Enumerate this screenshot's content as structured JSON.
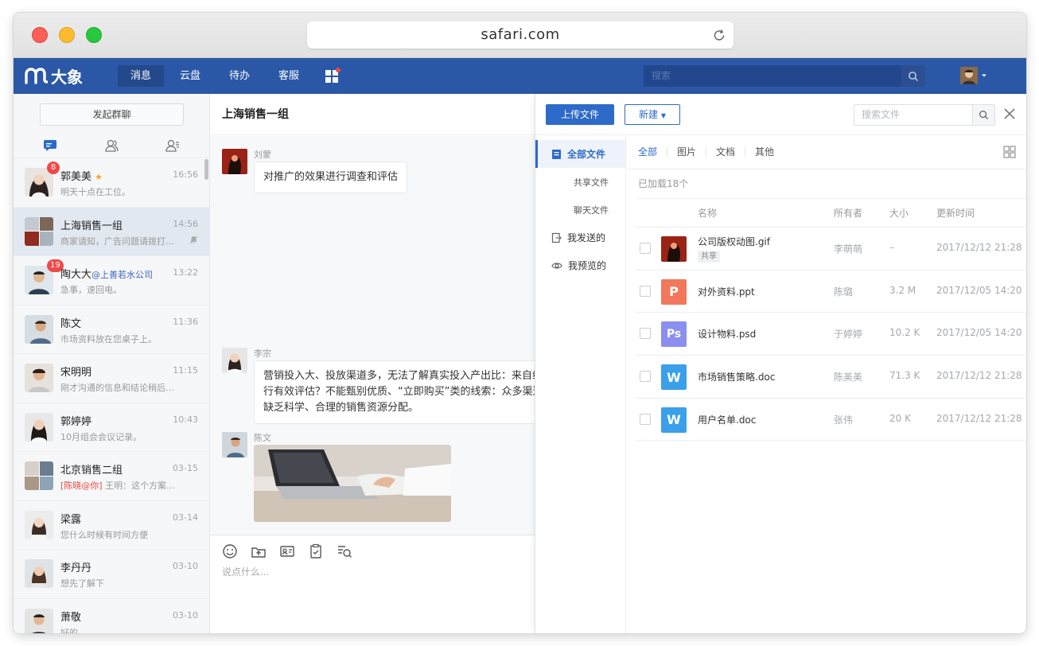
{
  "browser": {
    "url": "safari.com"
  },
  "app": {
    "logo_text": "大象",
    "nav": [
      "消息",
      "云盘",
      "待办",
      "客服"
    ],
    "search_placeholder": "搜索"
  },
  "sidebar": {
    "start_group": "发起群聊",
    "conversations": [
      {
        "name": "郭美美",
        "time": "16:56",
        "preview": "明天十点在工位。",
        "badge": "8",
        "starred": true
      },
      {
        "name": "上海销售一组",
        "time": "14:56",
        "preview": "商家请知，广告问题请拨打...",
        "group": true,
        "muted": true
      },
      {
        "name": "陶大大",
        "tag": "@上善若水公司",
        "time": "13:22",
        "preview": "急事，速回电。",
        "badge": "19"
      },
      {
        "name": "陈文",
        "time": "11:36",
        "preview": "市场资料放在您桌子上。"
      },
      {
        "name": "宋明明",
        "time": "11:15",
        "preview": "刚才沟通的信息和结论稍后我..."
      },
      {
        "name": "郭婷婷",
        "time": "10:43",
        "preview": "10月组会会议记录。"
      },
      {
        "name": "北京销售二组",
        "time": "03-15",
        "preview_highlight": "[陈晓@你]",
        "preview": " 王明：这个方案...",
        "group": true
      },
      {
        "name": "梁露",
        "time": "03-14",
        "preview": "您什么时候有时间方便"
      },
      {
        "name": "李丹丹",
        "time": "03-10",
        "preview": "想先了解下"
      },
      {
        "name": "萧敬",
        "time": "03-10",
        "preview": "好的"
      }
    ]
  },
  "chat": {
    "title": "上海销售一组",
    "messages": [
      {
        "sender": "刘蒙",
        "text": "对推广的效果进行调查和评估"
      },
      {
        "sender": "李宗",
        "lines": [
          "营销投入大、投放渠道多，无法了解真实投入产出比：来自线上",
          "行有效评估？不能甄别优质、“立即购买”类的线索：众多渠道来",
          "缺乏科学、合理的销售资源分配。"
        ]
      },
      {
        "sender": "陈文",
        "text": ""
      }
    ],
    "input_placeholder": "说点什么..."
  },
  "files": {
    "upload_label": "上传文件",
    "new_label": "新建",
    "search_placeholder": "搜索文件",
    "nav": [
      "全部文件",
      "共享文件",
      "聊天文件",
      "我发送的",
      "我预览的"
    ],
    "filters": [
      "全部",
      "图片",
      "文档",
      "其他"
    ],
    "loaded_text": "已加载18个",
    "columns": {
      "name": "名称",
      "owner": "所有者",
      "size": "大小",
      "updated": "更新时间"
    },
    "rows": [
      {
        "name": "公司版权动图.gif",
        "share_tag": "共享",
        "owner": "李萌萌",
        "size": "–",
        "updated": "2017/12/12 21:28",
        "type": "gif"
      },
      {
        "name": "对外资料.ppt",
        "owner": "陈璐",
        "size": "3.2 M",
        "updated": "2017/12/05 14:20",
        "type": "ppt",
        "icon_letter": "P"
      },
      {
        "name": "设计物料.psd",
        "owner": "于婷婷",
        "size": "10.2 K",
        "updated": "2017/12/05 14:20",
        "type": "psd",
        "icon_letter": "Ps"
      },
      {
        "name": "市场销售策略.doc",
        "owner": "陈美美",
        "size": "71.3 K",
        "updated": "2017/12/12 21:28",
        "type": "doc",
        "icon_letter": "W"
      },
      {
        "name": "用户名单.doc",
        "owner": "张伟",
        "size": "20 K",
        "updated": "2017/12/12 21:28",
        "type": "doc",
        "icon_letter": "W"
      }
    ]
  },
  "colors": {
    "brand": "#2b58a6",
    "accent": "#2d6ac9",
    "badge": "#f04848",
    "ppt": "#f2785c",
    "psd": "#8b8ff0",
    "doc": "#3aa0ea"
  }
}
